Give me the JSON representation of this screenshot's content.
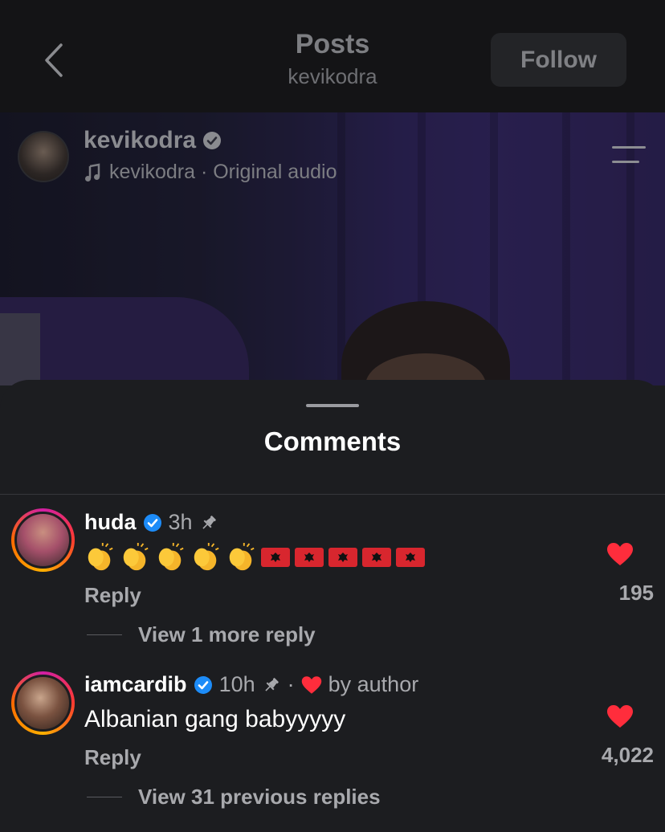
{
  "nav": {
    "title": "Posts",
    "subtitle": "kevikodra",
    "follow_label": "Follow"
  },
  "post": {
    "username": "kevikodra",
    "verified": true,
    "audio": "kevikodra · Original audio"
  },
  "comments_sheet": {
    "title": "Comments",
    "items": [
      {
        "username": "huda",
        "verified": true,
        "time": "3h",
        "pinned": true,
        "text_emoji": {
          "claps": 5,
          "albanian_flags": 5
        },
        "text": "",
        "reply_label": "Reply",
        "like_count": "195",
        "view_replies": "View 1 more reply"
      },
      {
        "username": "iamcardib",
        "verified": true,
        "time": "10h",
        "pinned": true,
        "separator": "·",
        "liked_by_author": "by author",
        "text": "Albanian gang babyyyyy",
        "reply_label": "Reply",
        "like_count": "4,022",
        "view_replies": "View 31 previous replies"
      }
    ]
  },
  "colors": {
    "like_red": "#ff2d3c",
    "verified_blue": "#1d8cf8",
    "sheet_bg": "#1c1d20",
    "avatar_ring": [
      "#d11ea5",
      "#ff3b30",
      "#ffb000"
    ]
  },
  "icons": [
    "back-chevron-icon",
    "verified-badge-icon",
    "music-note-icon",
    "menu-lines-icon",
    "pin-icon",
    "heart-icon",
    "clap-emoji-icon",
    "albania-flag-icon"
  ]
}
